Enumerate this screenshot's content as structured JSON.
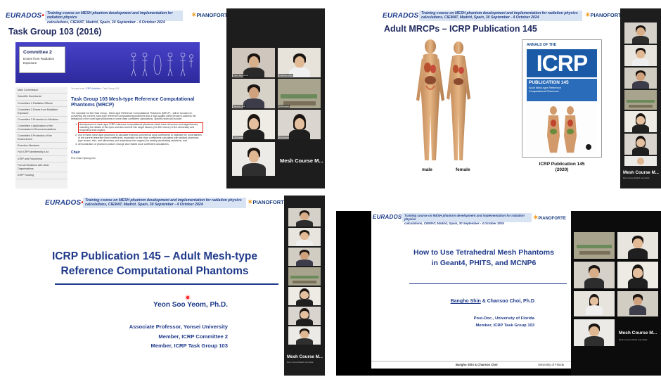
{
  "course_header": {
    "logo": "EURADOS",
    "line1": "Training course on MESH phantom development and implementation for radiation physics",
    "line2": "calculations, CIEMAT, Madrid, Spain, 30 September - 4 October 2024",
    "partner": "PIANOFORTE"
  },
  "shot1": {
    "title": "Task Group 103 (2016)",
    "banner_title": "Committee 2",
    "banner_sub": "Doses from Radiation Exposure",
    "sidebar": [
      "Main Commission",
      "Scientific Secretariat",
      "Committee 1 Radiation Effects",
      "Committee 2 Doses from Radiation Exposure",
      "Committee 3 Protection in Medicine",
      "Committee 4 Application of the Commission's Recommendations",
      "Committee 5 Protection of the Environment",
      "Emeritus Members",
      "Full ICRP Membership List",
      "ICRP and Fukushima",
      "Formal Relations with other Organisations",
      "ICRP Funding"
    ],
    "crumb_prefix": "You are here:",
    "crumb_link": "ICRP Activities",
    "crumb_tail": "Task Group 103",
    "heading": "Task Group 103 Mesh-type Reference Computational Phantoms (MRCP)",
    "intro": "The mandate for this Task Group - Mesh-type Reference Computational Phantoms (MRCP) - will be focused on converting the current voxel-type reference computational phantoms into a high-quality mesh format to address the limitations of the voxel-type phantoms in some dose coefficient calculations. Specific work will include:",
    "items": [
      "development of mesh-type ICRP reference computational phantoms which have all source and target tissues including the details of the eyes and skin and the thin target tissues (10-300 micron) of the alimentary and respiratory tract organs,",
      "use of these mesh-type phantoms to calculate external and internal dose coefficients to estimate the uncertainties of the current reference dose coefficients, especially for the dose coefficients calculated with stylized phantoms (eye lenses, skin, and alimentary and respiratory tract organs) for weakly penetrating radiations, and",
      "demonstration of phantom posture change and related dose coefficient calculations."
    ],
    "chair_label": "Chair",
    "chair_name": "Prof Chan Hyeong Kim",
    "mesh_label": "Mesh Course M...",
    "video_names": [
      "Yeon Soo Yeom",
      "Chansoo Choi",
      "Bangho Shin",
      "Participant",
      "Participant",
      "Participant"
    ]
  },
  "shot2": {
    "title": "Adult MRCPs – ICRP Publication 145",
    "male_label": "male",
    "female_label": "female",
    "book_top": "ANNALS OF THE",
    "book_logo": "ICRP",
    "book_pub": "PUBLICATION 145",
    "book_t1": "Adult Mesh-type Reference",
    "book_t2": "Computational Phantoms",
    "caption_line1": "ICRP Publication 145",
    "caption_line2": "(2020)",
    "mesh_label": "Mesh Course M...",
    "mesh_sub": "Mesh Course Madrid Juan Mella"
  },
  "shot3": {
    "title_line1": "ICRP Publication 145 – Adult Mesh-type",
    "title_line2": "Reference Computational Phantoms",
    "presenter": "Yeon Soo Yeom, Ph.D.",
    "aff1": "Associate Professor, Yonsei University",
    "aff2": "Member, ICRP Committee 2",
    "aff3": "Member, ICRP Task Group 103",
    "mesh_label": "Mesh Course M...",
    "mesh_sub": "Mesh Course Madrid Juan Mella"
  },
  "shot4": {
    "title_line1": "How to Use Tetrahedral Mesh Phantoms",
    "title_line2": "in Geant4, PHITS, and MCNP6",
    "presenter_main": "Bangho Shin",
    "presenter_rest": " & Chansoo Choi, Ph.D",
    "aff1": "Post-Doc., University of Florida",
    "aff2": "Member, ICRP Task Group 103",
    "footer_left": "Bangho Shin & Chansoo Choi",
    "footer_right": "University of Florida",
    "mesh_label": "Mesh Course M...",
    "mesh_sub": "Mesh Course Madrid Juan Mella"
  },
  "colors": {
    "title_blue": "#1f3a8a",
    "header_bar": "#d8e4f3",
    "accent_red": "#e2231a",
    "strip_bg": "#1d1d1d"
  }
}
